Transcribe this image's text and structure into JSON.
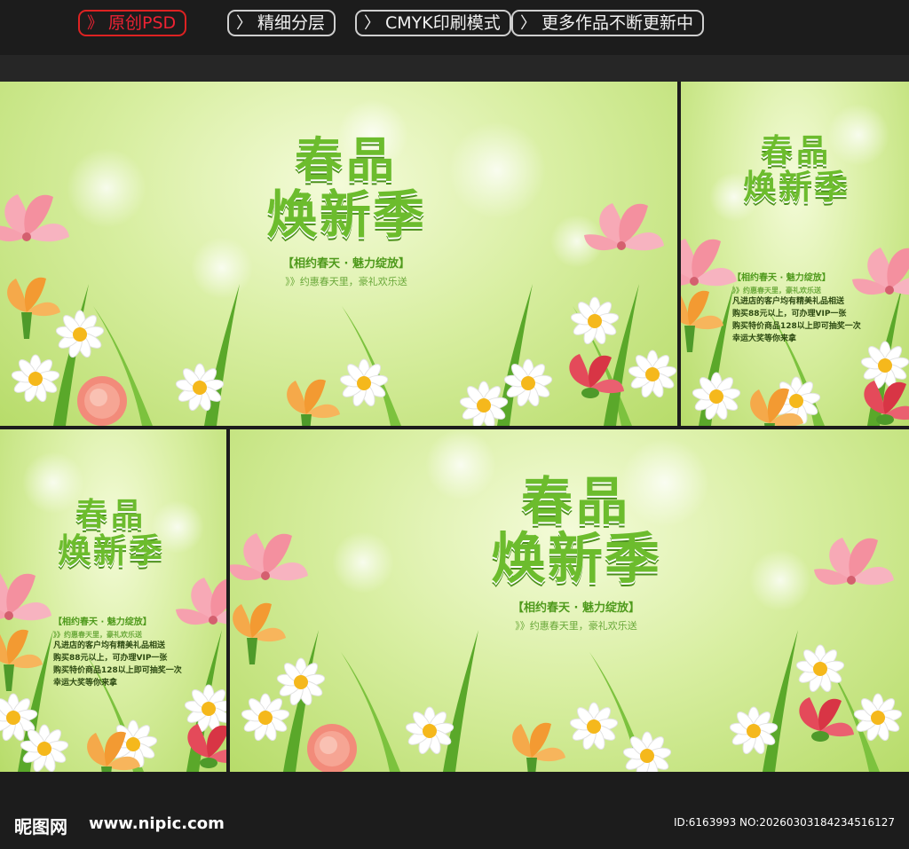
{
  "header": {
    "tags": [
      {
        "label": "原创PSD",
        "style": "red"
      },
      {
        "label": "精细分层",
        "style": "normal"
      },
      {
        "label": "CMYK印刷模式",
        "style": "normal"
      },
      {
        "label": "更多作品不断更新中",
        "style": "normal"
      }
    ]
  },
  "poster": {
    "title_line1": "春品",
    "title_line2": "焕新季",
    "slogan": "【相约春天 · 魅力绽放】",
    "subline": "》》约惠春天里，豪礼欢乐送",
    "offers": [
      "凡进店的客户均有精美礼品相送",
      "购买88元以上，可办理VIP一张",
      "购买特价商品128以上即可抽奖一次",
      "幸运大奖等你来拿"
    ]
  },
  "footer": {
    "logo": "昵图网",
    "site": "www.nipic.com",
    "id_text": "ID:6163993 NO:20260303184234516127"
  },
  "colors": {
    "title_green": "#6cbc2d",
    "background_green": "#c8e68a",
    "bar_dark": "#1c1c1c",
    "tag_red": "#dd2222"
  }
}
